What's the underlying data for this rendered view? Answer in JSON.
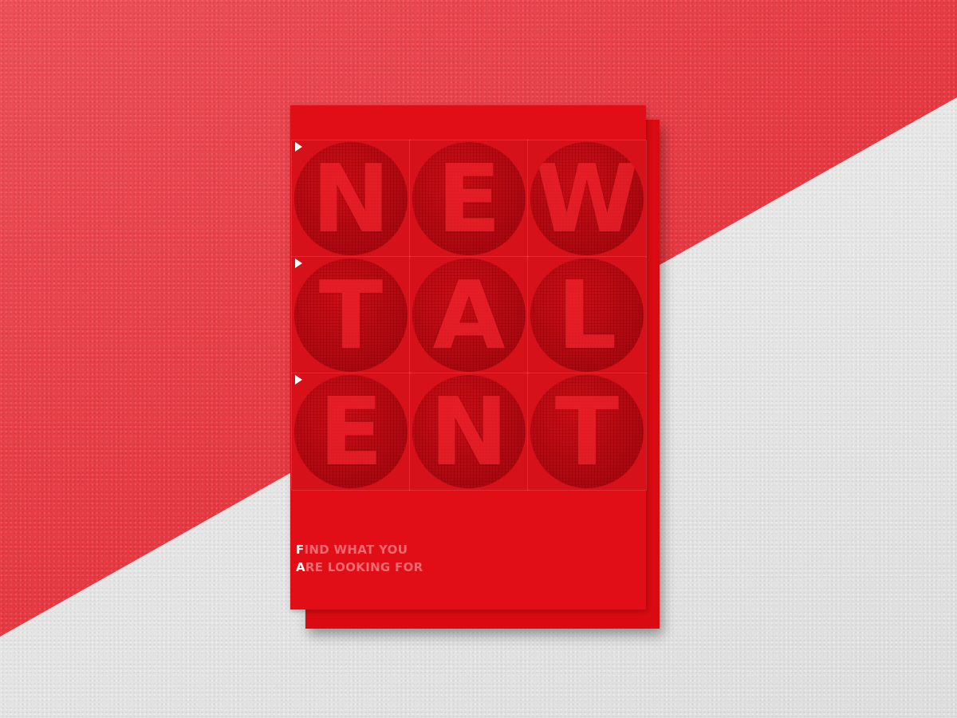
{
  "scene": {
    "colors": {
      "background_red": "#e63740",
      "background_white": "#e6e6e6",
      "poster_red": "#e20e17",
      "circle_red": "#b00c14"
    }
  },
  "poster": {
    "letters": [
      "N",
      "E",
      "W",
      "T",
      "A",
      "L",
      "E",
      "N",
      "T"
    ],
    "tagline": {
      "line1_first": "F",
      "line1_rest": "IND WHAT YOU",
      "line2_first": "A",
      "line2_rest": "RE LOOKING FOR"
    }
  }
}
